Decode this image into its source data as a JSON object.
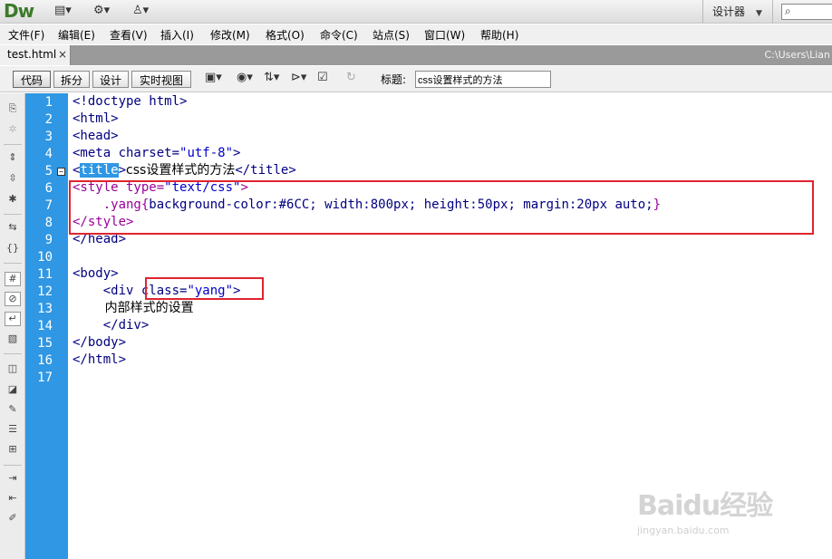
{
  "app": {
    "logo": "Dw",
    "designer_label": "设计器",
    "designer_arrow": "▼",
    "search_glyph": "⌕"
  },
  "menus": [
    "文件(F)",
    "编辑(E)",
    "查看(V)",
    "插入(I)",
    "修改(M)",
    "格式(O)",
    "命令(C)",
    "站点(S)",
    "窗口(W)",
    "帮助(H)"
  ],
  "document": {
    "tab_name": "test.html",
    "tab_close": "×",
    "path": "C:\\Users\\Lian"
  },
  "doc_toolbar": {
    "views": [
      "代码",
      "拆分",
      "设计",
      "实时视图"
    ],
    "title_label": "标题:",
    "title_value": "css设置样式的方法"
  },
  "line_numbers": [
    "1",
    "2",
    "3",
    "4",
    "5",
    "6",
    "7",
    "8",
    "9",
    "10",
    "11",
    "12",
    "13",
    "14",
    "15",
    "16",
    "17"
  ],
  "code": {
    "l1": "<!doctype html>",
    "l2": "<html>",
    "l3": "<head>",
    "l4a": "<meta charset=",
    "l4b": "\"utf-8\"",
    "l4c": ">",
    "l5a": "<",
    "l5b": "title",
    "l5c": ">",
    "l5d": "css设置样式的方法",
    "l5e": "</title>",
    "l6a": "<style type=",
    "l6b": "\"text/css\"",
    "l6c": ">",
    "l7a": "    .yang{",
    "l7b": "background-color:#6CC; width:800px; height:50px; margin:20px auto;",
    "l7c": "}",
    "l8": "</style>",
    "l9": "</head>",
    "l11": "<body>",
    "l12a": "    <div class=",
    "l12b": "\"yang\"",
    "l12c": ">",
    "l13": "        内部样式的设置",
    "l14": "    </div>",
    "l15": "</body>",
    "l16": "</html>"
  },
  "watermark": {
    "main": "Baidu经验",
    "sub": "jingyan.baidu.com"
  },
  "colors": {
    "gutter": "#2f97e3",
    "highlight": "#e0242e",
    "tag": "#000080",
    "css": "#990099",
    "string": "#0000cc"
  }
}
